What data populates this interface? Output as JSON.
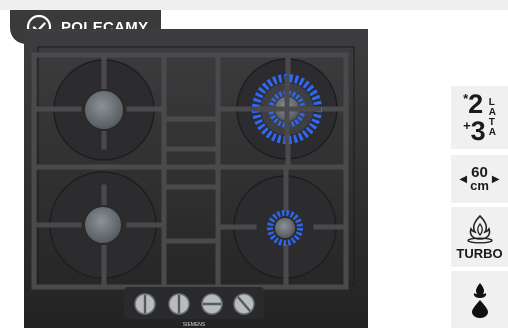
{
  "badge": {
    "label": "POLECAMY",
    "icon": "check-circle-icon"
  },
  "product": {
    "brand": "SIEMENS"
  },
  "features": {
    "warranty": {
      "top_sign": "*",
      "top_num": "2",
      "bottom_sign": "+",
      "bottom_num": "3",
      "letters": [
        "L",
        "A",
        "T",
        "A"
      ]
    },
    "size": {
      "value": "60",
      "unit": "cm"
    },
    "turbo": {
      "label": "TURBO",
      "icon": "turbo-flame-icon"
    },
    "fuel": {
      "icon": "gas-drop-icon"
    }
  },
  "colors": {
    "badge_bg": "#3a3a3a",
    "feature_bg": "#f0f0f0",
    "flame": "#2f6bff"
  }
}
